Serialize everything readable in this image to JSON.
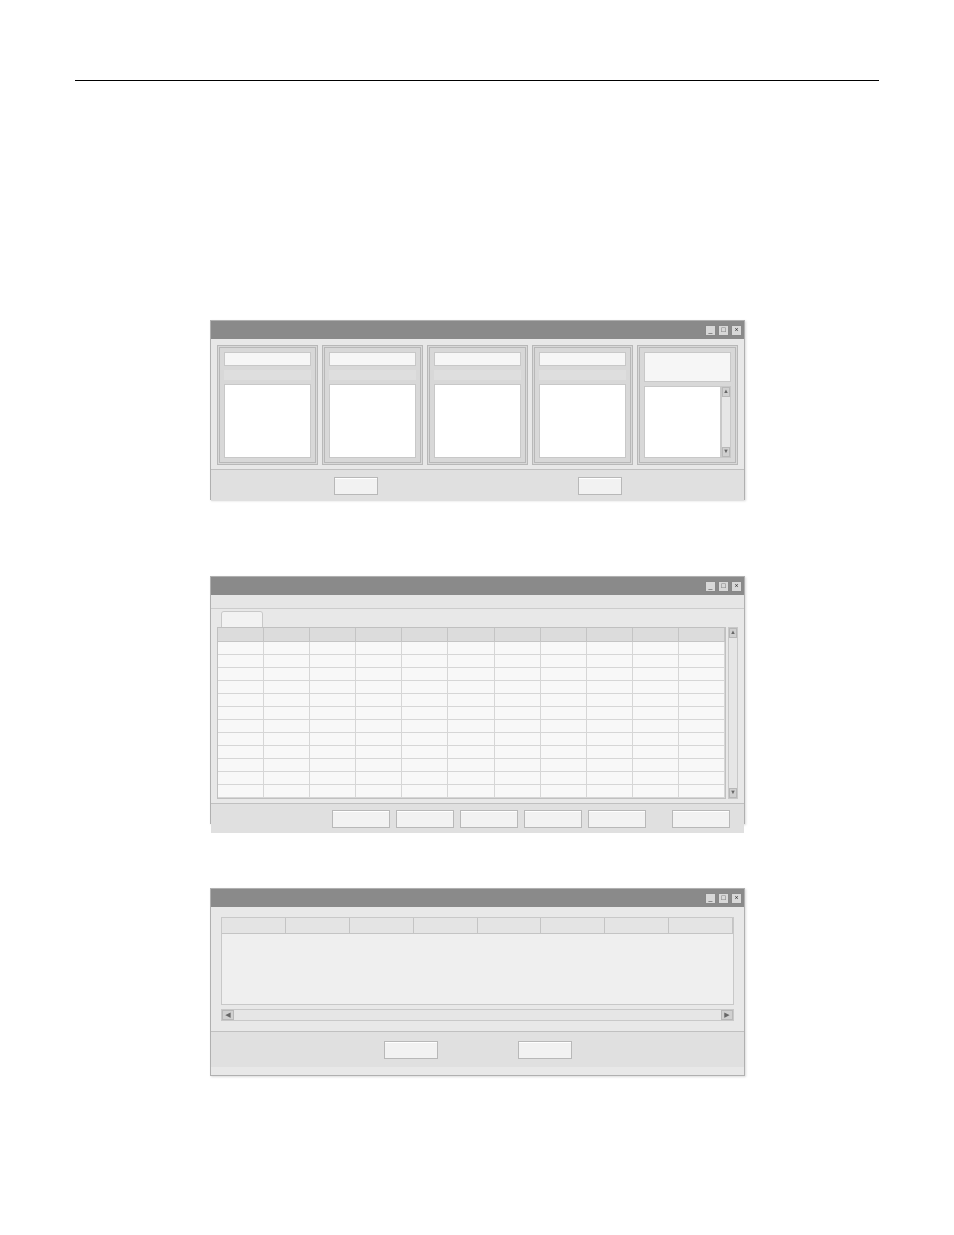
{
  "divider": {},
  "window1": {
    "title": "",
    "controls": {
      "min": "_",
      "max": "□",
      "close": "×"
    },
    "panels": [
      {
        "header": "",
        "stripe": "",
        "body": ""
      },
      {
        "header": "",
        "stripe": "",
        "body": ""
      },
      {
        "header": "",
        "stripe": "",
        "body": ""
      },
      {
        "header": "",
        "stripe": "",
        "body": ""
      },
      {
        "header": "",
        "body": ""
      }
    ],
    "buttons": {
      "left": "",
      "right": ""
    }
  },
  "window2": {
    "title": "",
    "controls": {
      "min": "_",
      "max": "□",
      "close": "×"
    },
    "tab": "",
    "columns": [
      "",
      "",
      "",
      "",
      "",
      "",
      "",
      "",
      "",
      "",
      ""
    ],
    "rows": 12,
    "buttons": [
      "",
      "",
      "",
      "",
      "",
      ""
    ]
  },
  "window3": {
    "title": "",
    "controls": {
      "min": "_",
      "max": "□",
      "close": "×"
    },
    "columns": [
      "",
      "",
      "",
      "",
      "",
      "",
      "",
      ""
    ],
    "buttons": {
      "left": "",
      "right": ""
    },
    "scroll": {
      "left": "◀",
      "right": "▶"
    }
  }
}
